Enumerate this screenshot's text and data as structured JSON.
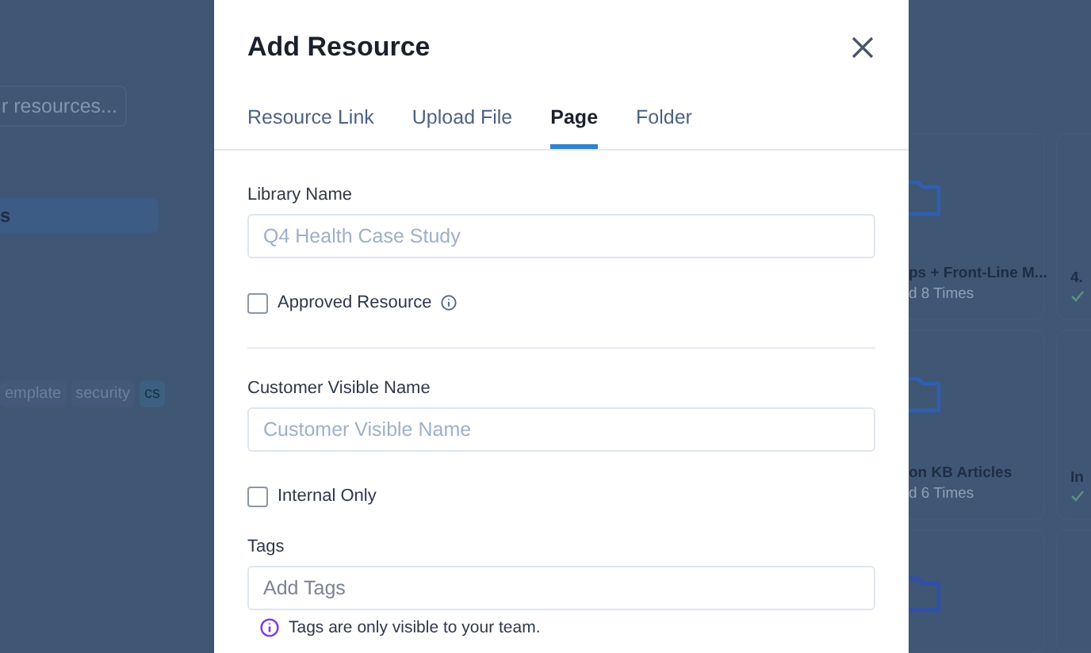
{
  "background": {
    "search": {
      "placeholder": "r resources..."
    },
    "sidebar_items": [
      {
        "label": "s",
        "selected": true
      }
    ],
    "tags": [
      {
        "label": "emplate",
        "selected": false
      },
      {
        "label": "security",
        "selected": false
      },
      {
        "label": "cs",
        "selected": true
      }
    ],
    "cards": [
      {
        "title": "ps + Front-Line M...",
        "subtitle": "d 8 Times",
        "verified": false
      },
      {
        "title": "4.",
        "verified": true
      },
      {
        "title": "on KB Articles",
        "subtitle": "d 6 Times",
        "verified": false
      },
      {
        "title": "In",
        "verified": true
      }
    ]
  },
  "dialog": {
    "title": "Add Resource",
    "tabs": [
      {
        "label": "Resource Link",
        "selected": false
      },
      {
        "label": "Upload File",
        "selected": false
      },
      {
        "label": "Page",
        "selected": true
      },
      {
        "label": "Folder",
        "selected": false
      }
    ],
    "fields": [
      {
        "kind": "text",
        "label": "Library Name",
        "placeholder": "Q4 Health Case Study"
      },
      {
        "kind": "checkbox",
        "label": "Approved Resource",
        "checked": false,
        "info": true
      },
      {
        "kind": "divider"
      },
      {
        "kind": "text",
        "label": "Customer Visible Name",
        "placeholder": "Customer Visible Name"
      },
      {
        "kind": "checkbox",
        "label": "Internal Only",
        "checked": false,
        "info": false
      },
      {
        "kind": "text",
        "label": "Tags",
        "placeholder": "Add Tags",
        "note": "Tags are only visible to your team."
      }
    ]
  }
}
